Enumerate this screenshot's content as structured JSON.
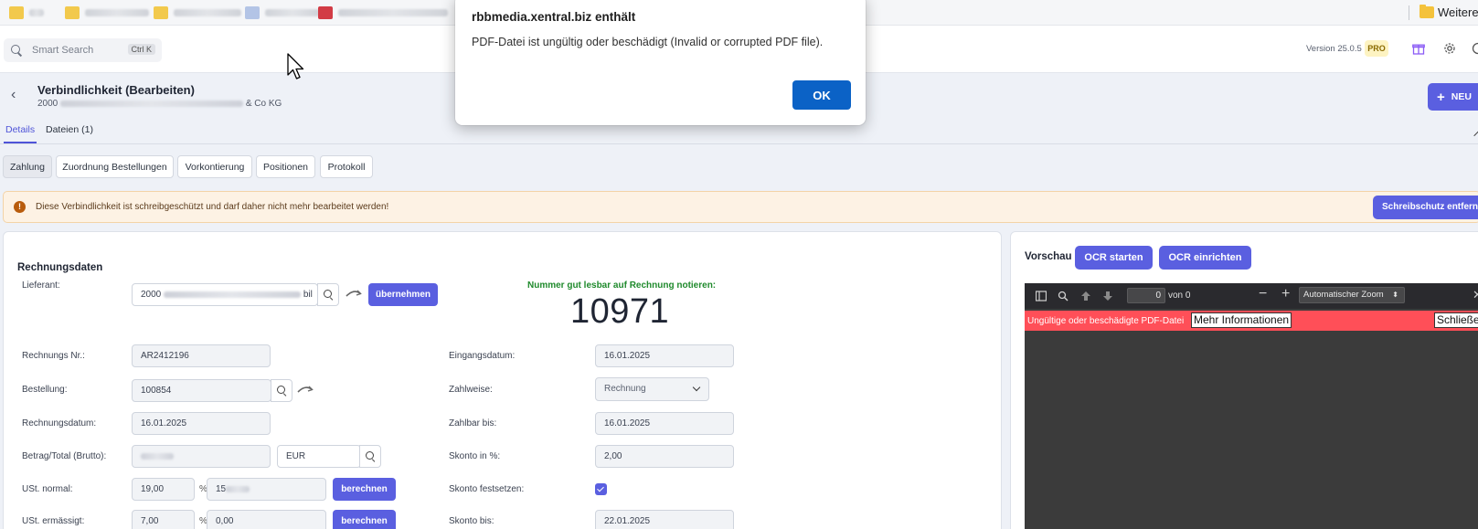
{
  "browser": {
    "more_bookmarks_label": "Weitere"
  },
  "topbar": {
    "search_placeholder": "Smart Search",
    "search_shortcut": "Ctrl K",
    "version": "Version 25.0.5",
    "plan_badge": "PRO"
  },
  "page": {
    "title": "Verbindlichkeit (Bearbeiten)",
    "subtitle_prefix": "2000",
    "subtitle_suffix": "& Co KG",
    "new_button": "NEU"
  },
  "main_tabs": [
    {
      "label": "Details"
    },
    {
      "label": "Dateien (1)"
    }
  ],
  "sub_tabs": [
    {
      "label": "Zahlung"
    },
    {
      "label": "Zuordnung Bestellungen"
    },
    {
      "label": "Vorkontierung"
    },
    {
      "label": "Positionen"
    },
    {
      "label": "Protokoll"
    }
  ],
  "warning": {
    "text": "Diese Verbindlichkeit ist schreibgeschützt und darf daher nicht mehr bearbeitet werden!",
    "button": "Schreibschutz entfern"
  },
  "form": {
    "section_title": "Rechnungsdaten",
    "hint": "Nummer gut lesbar auf Rechnung notieren:",
    "big_number": "10971",
    "supplier_label": "Lieferant:",
    "supplier_value_prefix": "2000",
    "supplier_value_suffix": "bil",
    "apply_button": "übernehmen",
    "invoice_no_label": "Rechnungs Nr.:",
    "invoice_no_value": "AR2412196",
    "order_label": "Bestellung:",
    "order_value": "100854",
    "invoice_date_label": "Rechnungsdatum:",
    "invoice_date_value": "16.01.2025",
    "amount_label": "Betrag/Total (Brutto):",
    "currency_value": "EUR",
    "vat_normal_label": "USt. normal:",
    "vat_normal_rate": "19,00",
    "vat_reduced_label": "USt. ermässigt:",
    "vat_reduced_rate": "7,00",
    "vat_reduced_amount": "0,00",
    "vat_amount_prefix": "15",
    "percent_sign": "%",
    "calc_button": "berechnen",
    "receipt_date_label": "Eingangsdatum:",
    "receipt_date_value": "16.01.2025",
    "payment_method_label": "Zahlweise:",
    "payment_method_value": "Rechnung",
    "payable_until_label": "Zahlbar bis:",
    "payable_until_value": "16.01.2025",
    "discount_pct_label": "Skonto in %:",
    "discount_pct_value": "2,00",
    "discount_fix_label": "Skonto festsetzen:",
    "discount_fix_checked": true,
    "discount_until_label": "Skonto bis:",
    "discount_until_value": "22.01.2025"
  },
  "preview": {
    "title": "Vorschau",
    "ocr_start": "OCR starten",
    "ocr_setup": "OCR einrichten",
    "page_input": "0",
    "page_of": "von 0",
    "zoom": "Automatischer Zoom",
    "error_text": "Ungültige oder beschädigte PDF-Datei",
    "more_info": "Mehr Informationen",
    "close": "Schließen"
  },
  "dialog": {
    "title": "rbbmedia.xentral.biz enthält",
    "message": "PDF-Datei ist ungültig oder beschädigt (Invalid or corrupted PDF file).",
    "ok": "OK"
  },
  "colors": {
    "accent": "#5a5fe0",
    "dialog_ok": "#0b62c6",
    "pdf_error": "#ff4f58",
    "hint_green": "#1f8a2c",
    "warning_bg": "#fdf2e4"
  }
}
